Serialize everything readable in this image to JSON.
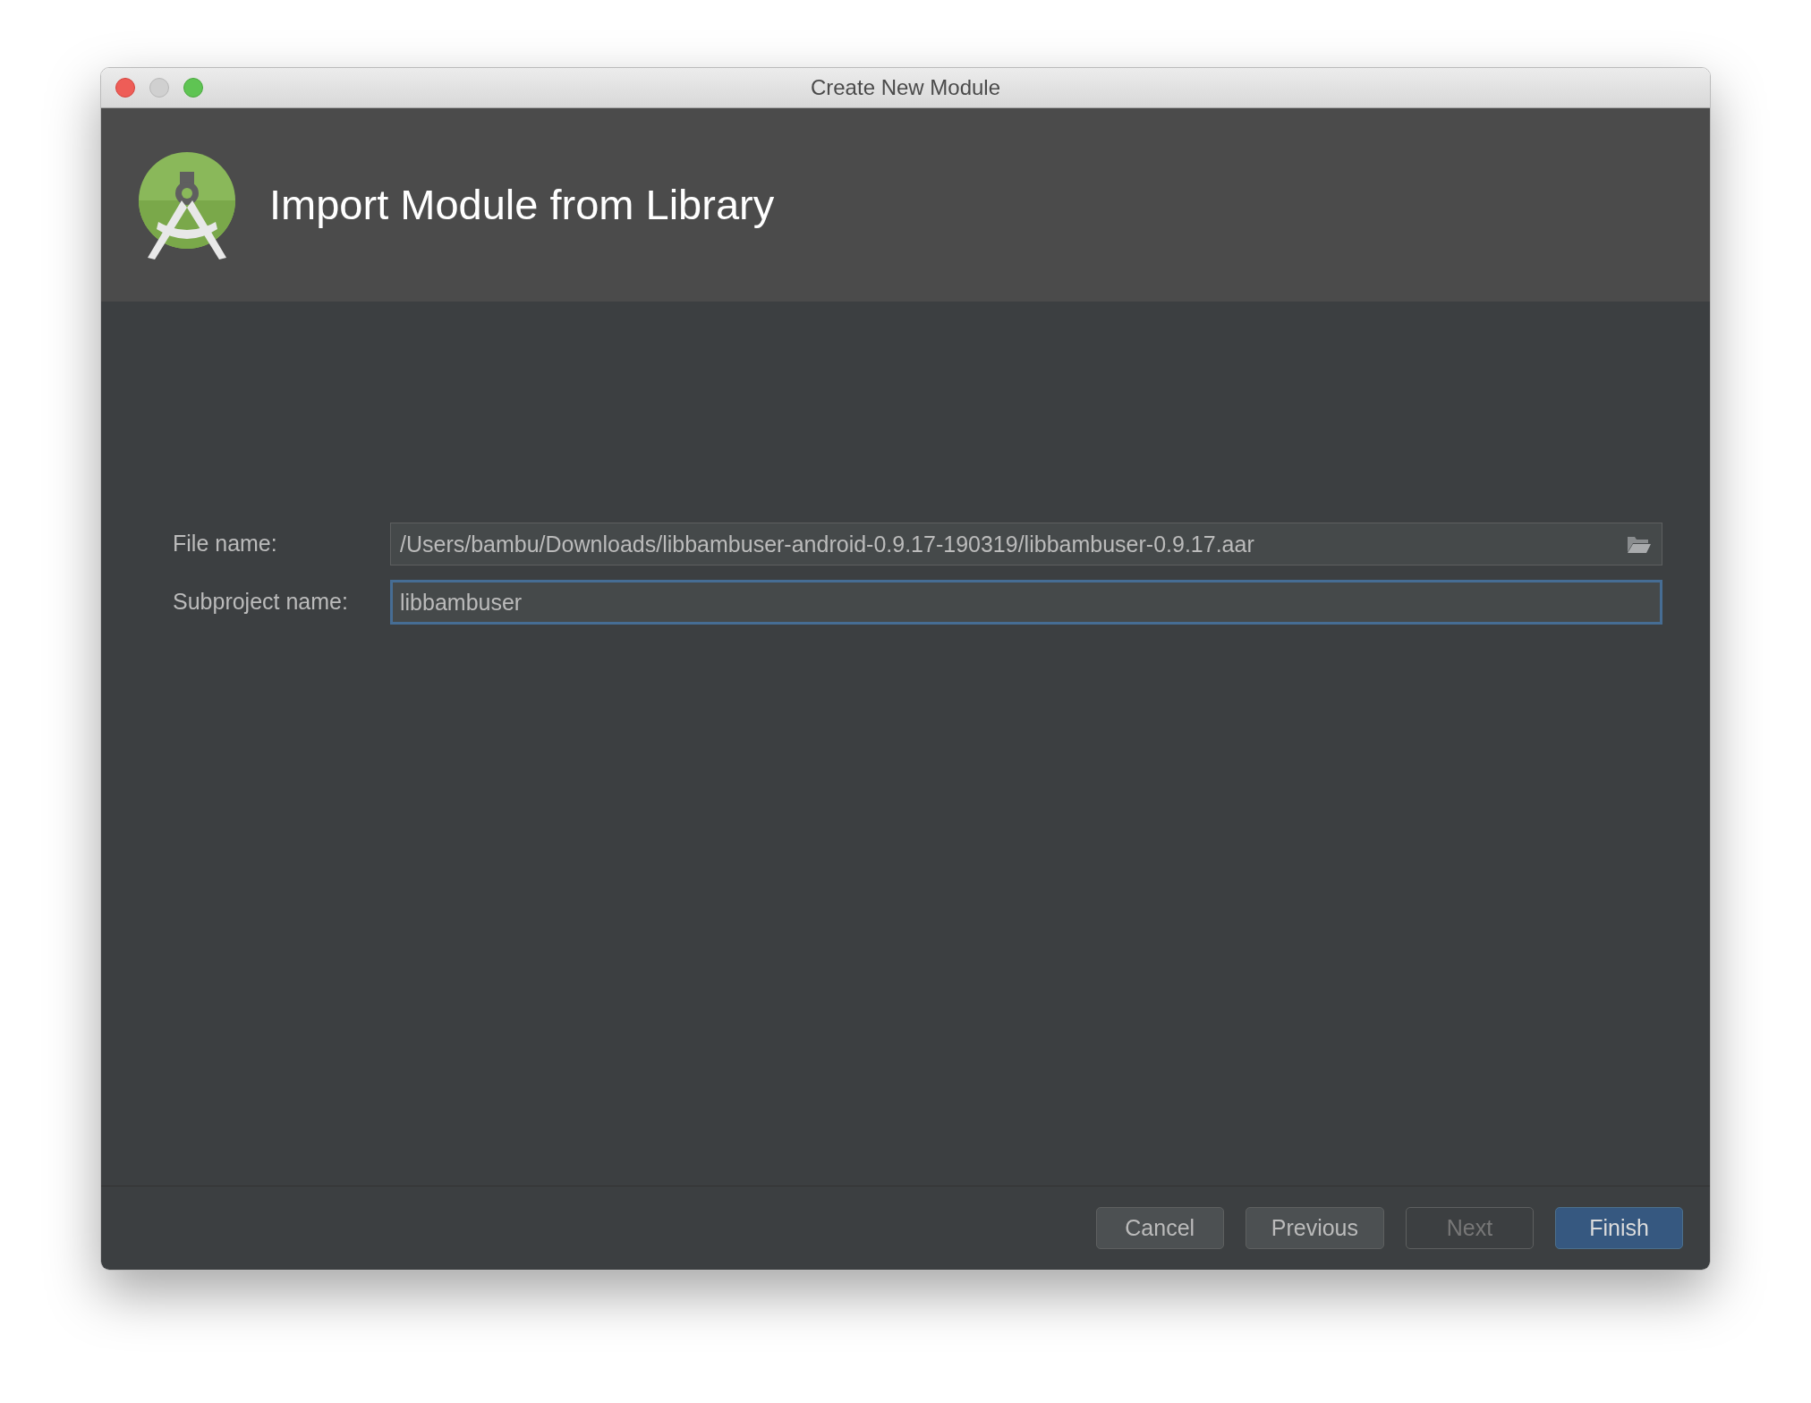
{
  "window": {
    "title": "Create New Module"
  },
  "header": {
    "title": "Import Module from Library"
  },
  "fields": [
    {
      "kind": "file",
      "label": "File name:",
      "value": "/Users/bambu/Downloads/libbambuser-android-0.9.17-190319/libbambuser-0.9.17.aar",
      "focused": false
    },
    {
      "kind": "text",
      "label": "Subproject name:",
      "value": "libbambuser",
      "focused": true
    }
  ],
  "buttons": [
    {
      "label": "Cancel",
      "disabled": false,
      "default": false
    },
    {
      "label": "Previous",
      "disabled": false,
      "default": false
    },
    {
      "label": "Next",
      "disabled": true,
      "default": false
    },
    {
      "label": "Finish",
      "disabled": false,
      "default": true
    }
  ]
}
